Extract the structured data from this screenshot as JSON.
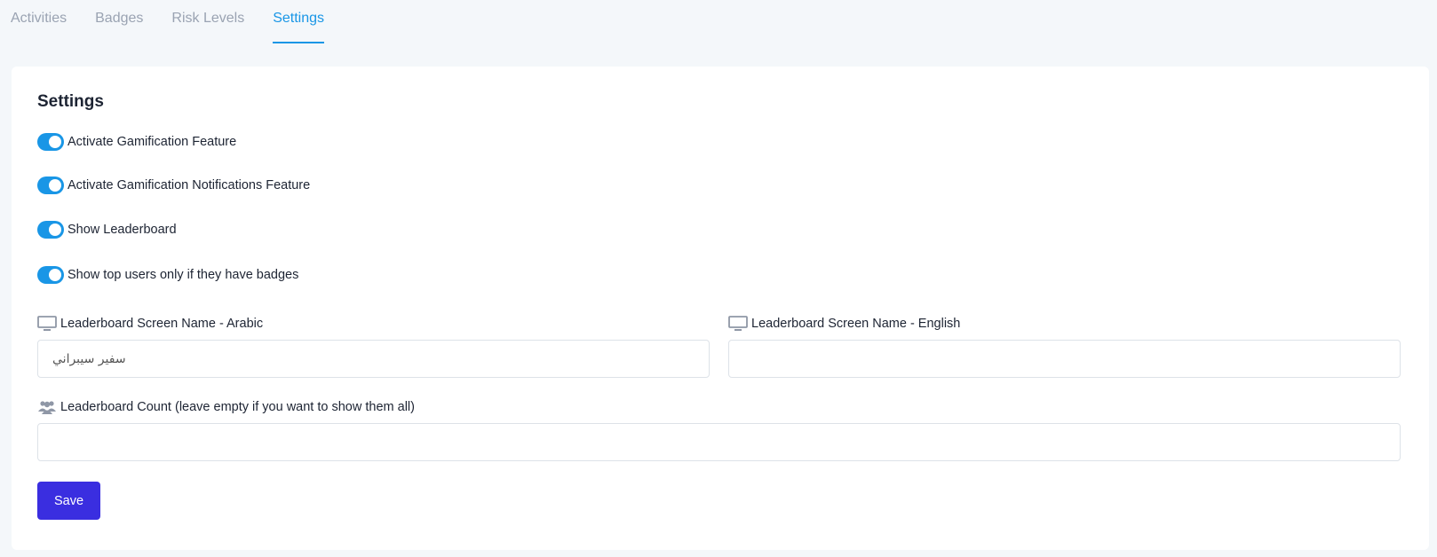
{
  "tabs": [
    {
      "label": "Activities"
    },
    {
      "label": "Badges"
    },
    {
      "label": "Risk Levels"
    },
    {
      "label": "Settings"
    }
  ],
  "settings": {
    "title": "Settings",
    "toggles": [
      {
        "label": "Activate Gamification Feature",
        "on": true
      },
      {
        "label": "Activate Gamification Notifications Feature",
        "on": true
      },
      {
        "label": "Show Leaderboard",
        "on": true
      },
      {
        "label": "Show top users only if they have badges",
        "on": true
      }
    ],
    "fields": {
      "arabic_name": {
        "label": "Leaderboard Screen Name - Arabic",
        "value": "سفير سيبراني",
        "icon": "monitor-icon"
      },
      "english_name": {
        "label": "Leaderboard Screen Name - English",
        "value": "",
        "icon": "monitor-icon"
      },
      "count": {
        "label": "Leaderboard Count (leave empty if you want to show them all)",
        "value": "",
        "icon": "users-icon"
      }
    },
    "save_label": "Save"
  },
  "colors": {
    "accent": "#1996e6",
    "primary_button": "#3a2ee0",
    "background": "#f4f7fa"
  }
}
